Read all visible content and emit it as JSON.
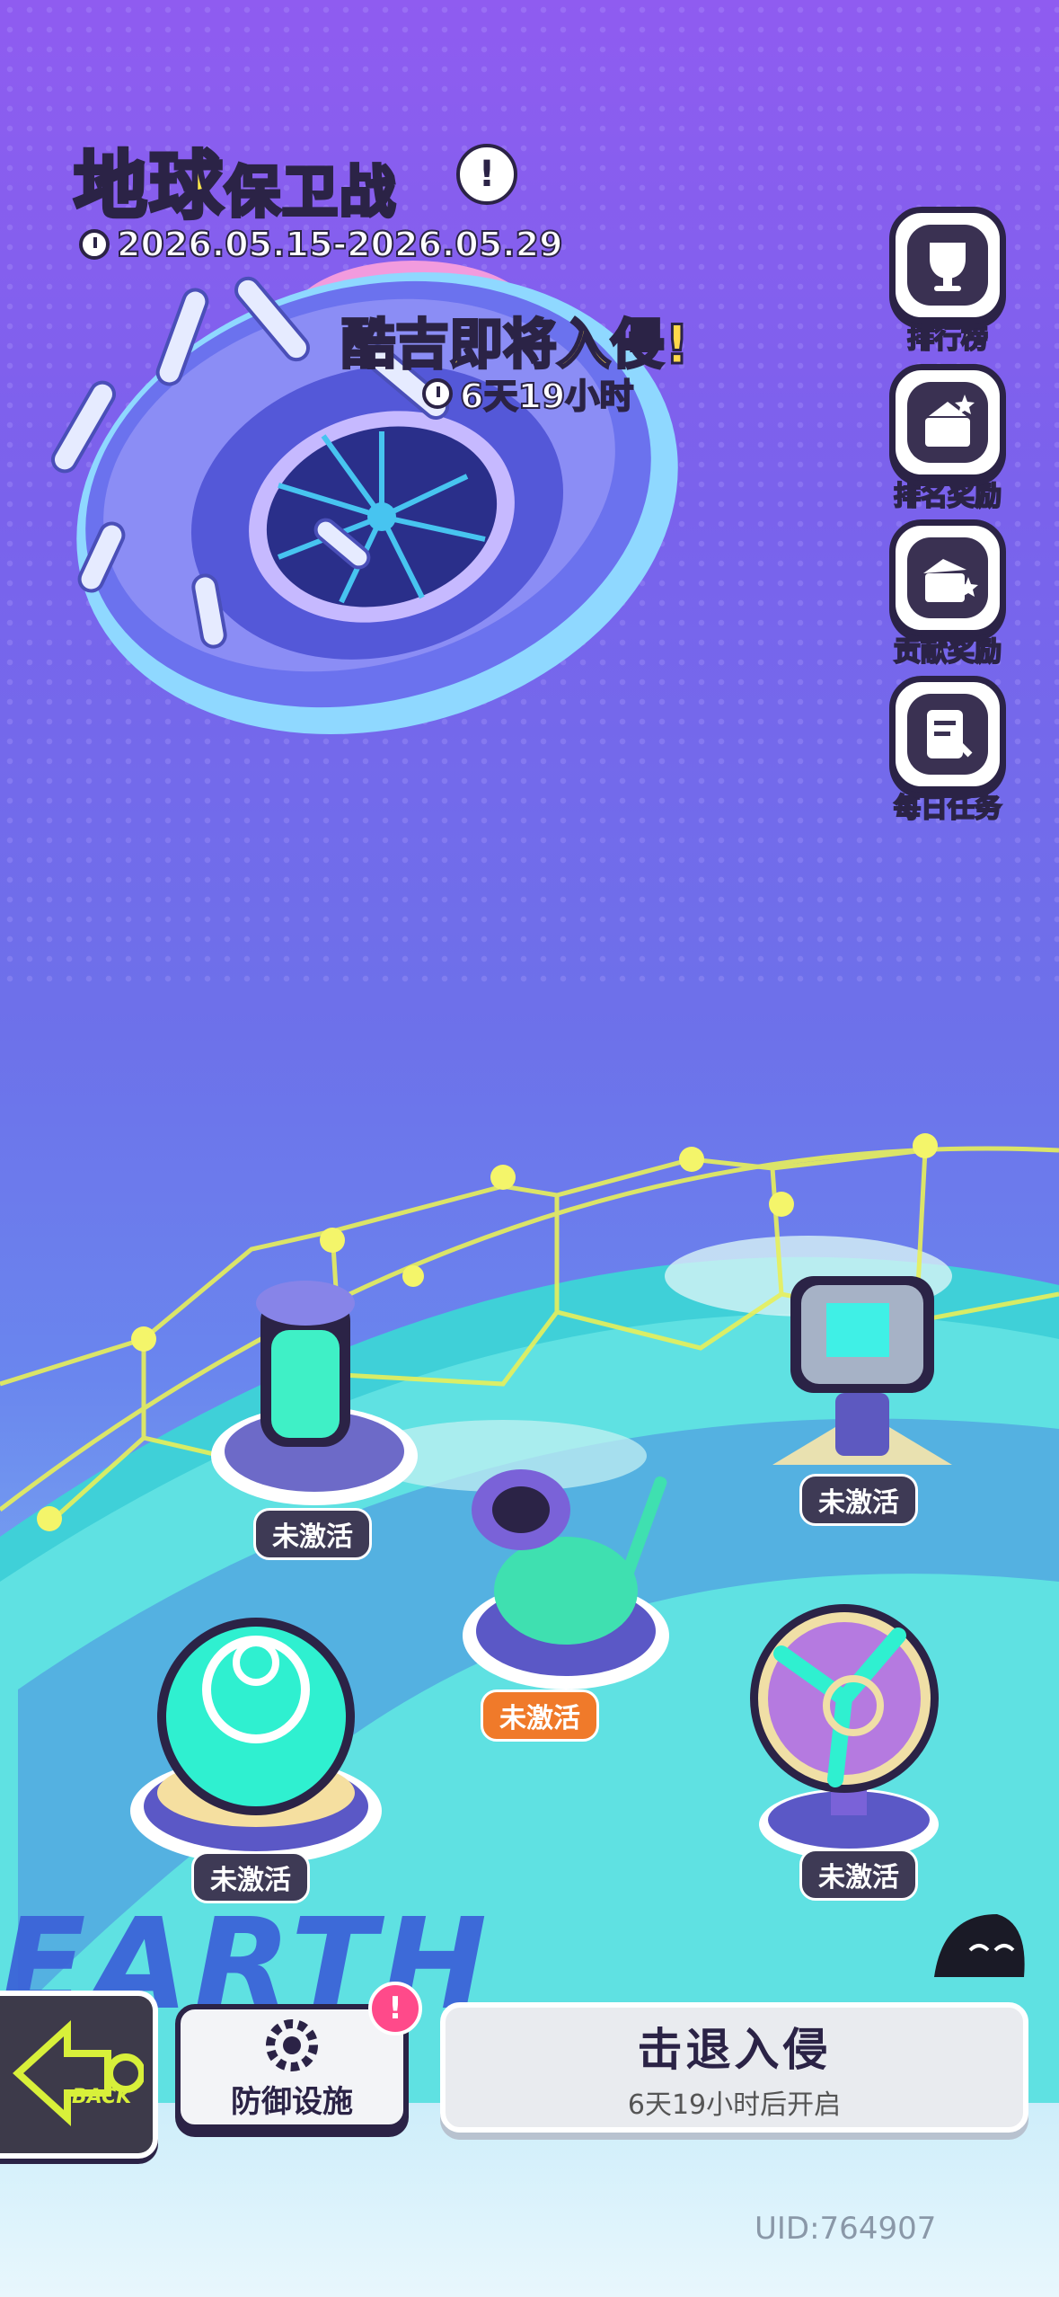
{
  "header": {
    "title_main": "地球",
    "title_rest": "保卫战",
    "info_icon": "info-icon",
    "date_range": "2026.05.15-2026.05.29",
    "invade_text": "酷吉即将入侵!",
    "countdown": "6天19小时"
  },
  "side_menu": [
    {
      "label": "排行榜",
      "icon": "trophy-icon"
    },
    {
      "label": "排名奖励",
      "icon": "gift-box-icon"
    },
    {
      "label": "贡献奖励",
      "icon": "reward-box-icon"
    },
    {
      "label": "每日任务",
      "icon": "task-list-icon"
    }
  ],
  "towers": [
    {
      "name": "capsule-tower",
      "status": "未激活"
    },
    {
      "name": "laser-tower",
      "status": "未激活"
    },
    {
      "name": "cannon-tower",
      "status": "未激活"
    },
    {
      "name": "dome-tower",
      "status": "未激活"
    },
    {
      "name": "fan-tower",
      "status": "未激活"
    }
  ],
  "earth_word": "EARTH",
  "bottom": {
    "back_label": "BACK",
    "defense_label": "防御设施",
    "defense_badge": "!",
    "repel_title": "击退入侵",
    "repel_sub": "6天19小时后开启"
  },
  "uid": "UID:764907",
  "colors": {
    "title_yellow": "#ffe84a",
    "outline": "#2b2346",
    "badge_pink": "#ff4a8a",
    "fire_tag": "#f07a2a"
  }
}
